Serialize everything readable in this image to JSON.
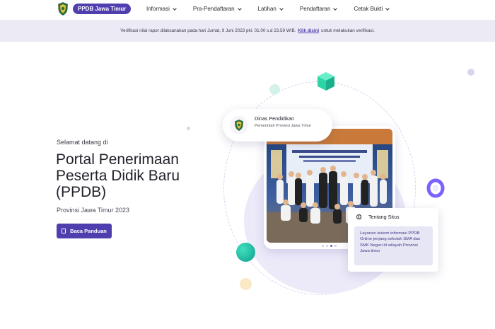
{
  "navbar": {
    "brand": "PPDB Jawa Timur",
    "menu": [
      {
        "label": "Informasi"
      },
      {
        "label": "Pra-Pendaftaran"
      },
      {
        "label": "Latihan"
      },
      {
        "label": "Pendaftaran"
      },
      {
        "label": "Cetak Bukti"
      }
    ]
  },
  "notice": {
    "text_before": "Verifikasi nilai rapor dilaksanakan pada hari Jumat, 9 Juni 2023 pkl. 01.00 s.d 23.59 WIB.",
    "link": "Klik disini",
    "text_after": "untuk melakukan verifikasi."
  },
  "hero": {
    "welcome": "Selamat datang di",
    "title": "Portal Penerimaan Peserta Didik Baru (PPDB)",
    "subtitle": "Provinsi Jawa Timur 2023",
    "cta": "Baca Panduan"
  },
  "dinas_card": {
    "title": "Dinas Pendidikan",
    "subtitle": "Pemerintah Provinsi Jawa Timur"
  },
  "tentang_card": {
    "title": "Tentang Situs",
    "body": "Layanan sistem informasi PPDB Online jenjang sekolah SMA dan SMK Negeri di wilayah Provinsi Jawa timur"
  },
  "icons": {
    "logo": "jawa-timur-emblem-icon",
    "menu_chevron": "chevron-down-icon",
    "cta_icon": "book-icon",
    "tentang_icon": "globe-icon"
  },
  "colors": {
    "primary": "#4f3fae",
    "notice_bg": "#ecebf5",
    "accent_green": "#2fd3a8",
    "accent_teal": "#13b3a1",
    "accent_purple": "#7b61ff"
  },
  "carousel": {
    "total": 4,
    "active": 3
  }
}
